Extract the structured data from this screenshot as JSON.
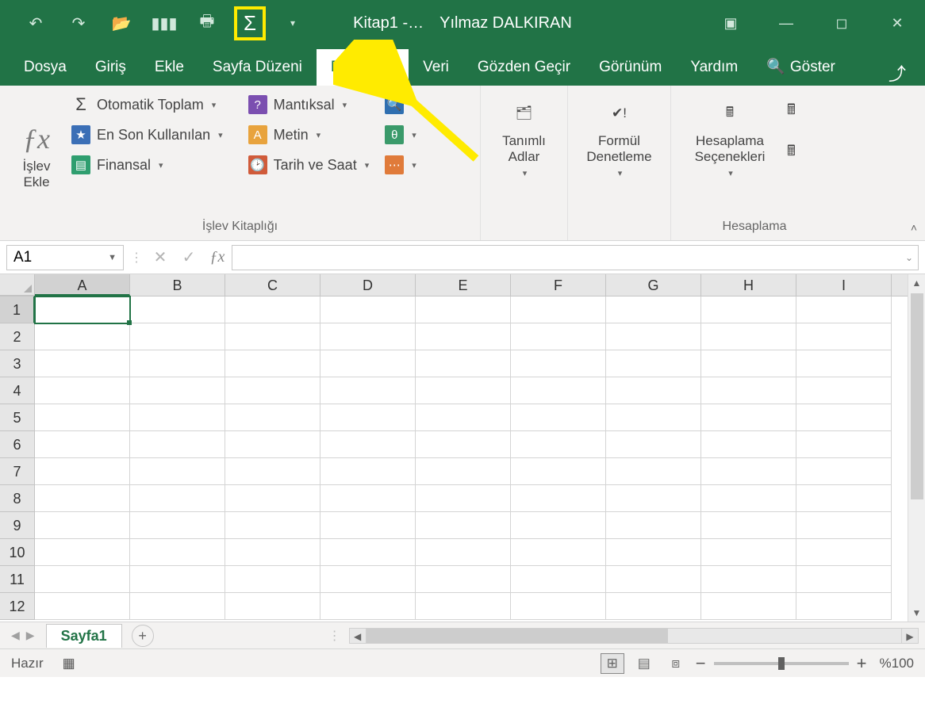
{
  "title": {
    "doc": "Kitap1 -…",
    "user": "Yılmaz DALKIRAN"
  },
  "qat": {
    "sigma": "Σ"
  },
  "tabs": {
    "file": "Dosya",
    "home": "Giriş",
    "insert": "Ekle",
    "layout": "Sayfa Düzeni",
    "formulas": "Formüller",
    "data": "Veri",
    "review": "Gözden Geçir",
    "view": "Görünüm",
    "help": "Yardım",
    "tellme": "Göster"
  },
  "ribbon": {
    "fx_label": "İşlev\nEkle",
    "lib": {
      "autosum": "Otomatik Toplam",
      "recent": "En Son Kullanılan",
      "financial": "Finansal",
      "logical": "Mantıksal",
      "text": "Metin",
      "datetime": "Tarih ve Saat",
      "group_label": "İşlev Kitaplığı"
    },
    "names": {
      "label": "Tanımlı\nAdlar"
    },
    "audit": {
      "label": "Formül\nDenetleme"
    },
    "calc": {
      "label": "Hesaplama\nSeçenekleri",
      "group_label": "Hesaplama"
    }
  },
  "namebox": "A1",
  "columns": [
    "A",
    "B",
    "C",
    "D",
    "E",
    "F",
    "G",
    "H",
    "I"
  ],
  "rows": [
    "1",
    "2",
    "3",
    "4",
    "5",
    "6",
    "7",
    "8",
    "9",
    "10",
    "11",
    "12"
  ],
  "sheet": {
    "name": "Sayfa1"
  },
  "status": {
    "ready": "Hazır",
    "zoom": "%100"
  }
}
